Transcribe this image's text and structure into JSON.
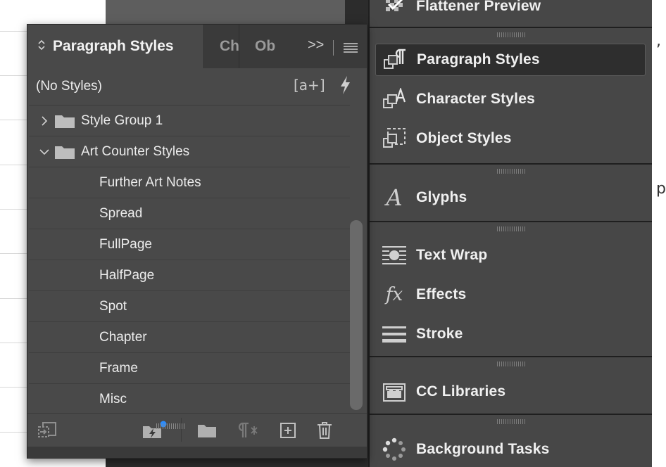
{
  "panel": {
    "active_tab": "Paragraph Styles",
    "inactive_tabs": [
      "Ch",
      "Ob"
    ],
    "overflow_glyph": ">>",
    "header_label": "(No Styles)",
    "header_bracket": "[a+]",
    "items": [
      {
        "label": "Style Group 1",
        "kind": "group",
        "expanded": false
      },
      {
        "label": "Art Counter Styles",
        "kind": "group",
        "expanded": true
      },
      {
        "label": "Further Art Notes",
        "kind": "style"
      },
      {
        "label": "Spread",
        "kind": "style"
      },
      {
        "label": "FullPage",
        "kind": "style"
      },
      {
        "label": "HalfPage",
        "kind": "style"
      },
      {
        "label": "Spot",
        "kind": "style"
      },
      {
        "label": "Chapter",
        "kind": "style"
      },
      {
        "label": "Frame",
        "kind": "style"
      },
      {
        "label": "Misc",
        "kind": "style"
      }
    ],
    "footer_icons": [
      "load-styles-icon",
      "quick-apply-folder-icon",
      "new-group-icon",
      "clear-overrides-icon",
      "new-style-icon",
      "delete-icon"
    ]
  },
  "dock": {
    "top_item": "Flattener Preview",
    "groups": [
      [
        "Paragraph Styles",
        "Character Styles",
        "Object Styles"
      ],
      [
        "Glyphs"
      ],
      [
        "Text Wrap",
        "Effects",
        "Stroke"
      ],
      [
        "CC Libraries"
      ],
      [
        "Background Tasks"
      ]
    ],
    "active_item": "Paragraph Styles"
  },
  "colors": {
    "panel_bg": "#494949",
    "dock_bg": "#474747",
    "accent_dot": "#2a8cff"
  }
}
